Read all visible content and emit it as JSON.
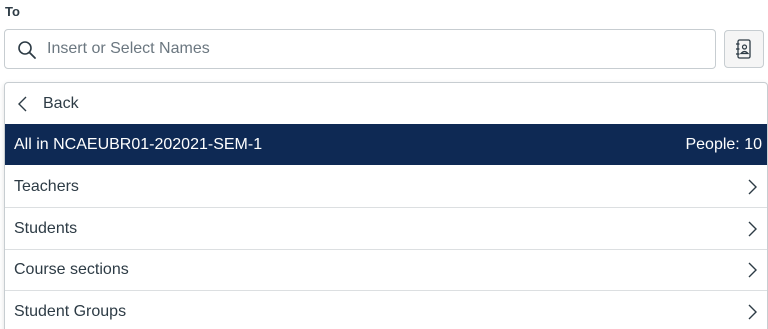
{
  "compose": {
    "to_label": "To"
  },
  "search": {
    "placeholder": "Insert or Select Names",
    "value": ""
  },
  "menu": {
    "back_label": "Back",
    "selected": {
      "label": "All in NCAEUBR01-202021-SEM-1",
      "count": "People: 10"
    },
    "items": [
      {
        "label": "Teachers"
      },
      {
        "label": "Students"
      },
      {
        "label": "Course sections"
      },
      {
        "label": "Student Groups"
      }
    ]
  },
  "colors": {
    "selected_bg": "#0e2954",
    "text": "#2d3b45",
    "border": "#c7cdd1"
  },
  "icons": {
    "search": "search-icon",
    "address_book": "address-book-icon",
    "back": "chevron-left-icon",
    "forward": "chevron-right-icon"
  }
}
